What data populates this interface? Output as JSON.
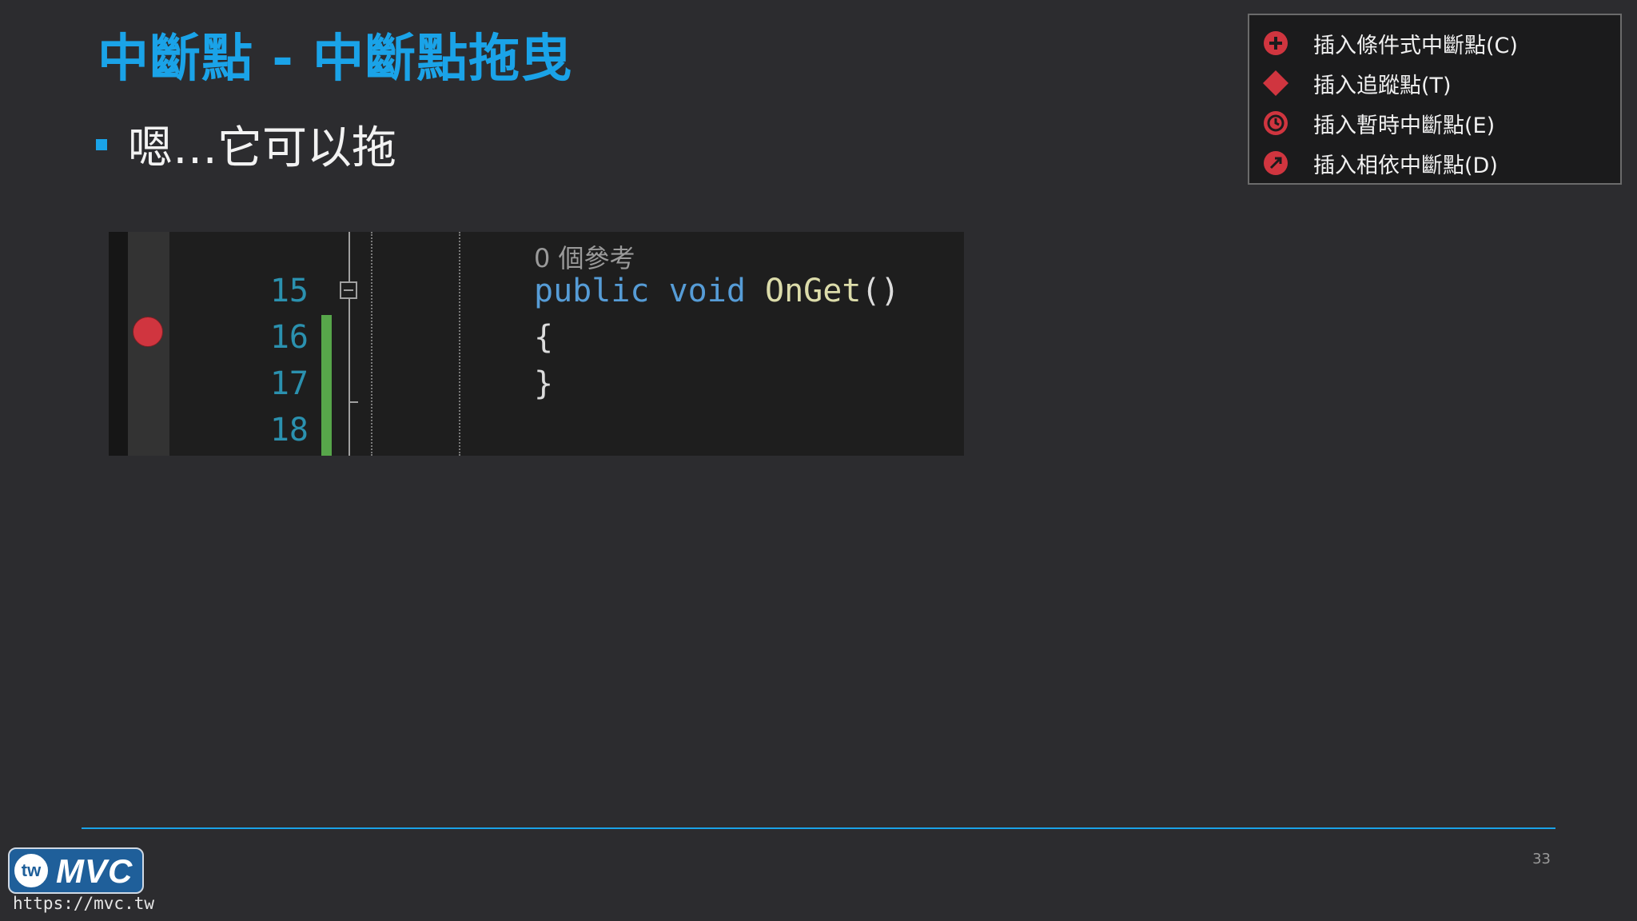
{
  "slide": {
    "title": "中斷點 - 中斷點拖曳",
    "bullet": "嗯…它可以拖",
    "page_number": "33",
    "colors": {
      "accent": "#1aa3e8",
      "background": "#2c2c2f",
      "breakpoint": "#d0353f"
    }
  },
  "editor": {
    "codelens": "0 個參考",
    "line_numbers": [
      "15",
      "16",
      "17",
      "18"
    ],
    "code": {
      "kw_public": "public",
      "kw_void": "void",
      "method": "OnGet",
      "parens": "()",
      "open_brace": "{",
      "close_brace": "}"
    }
  },
  "context_menu": {
    "items": [
      {
        "label": "插入條件式中斷點(C)",
        "icon": "conditional-breakpoint-icon"
      },
      {
        "label": "插入追蹤點(T)",
        "icon": "tracepoint-icon"
      },
      {
        "label": "插入暫時中斷點(E)",
        "icon": "temporary-breakpoint-icon"
      },
      {
        "label": "插入相依中斷點(D)",
        "icon": "dependent-breakpoint-icon"
      }
    ]
  },
  "footer": {
    "logo_badge": "tw",
    "logo_text": "MVC",
    "url": "https://mvc.tw"
  }
}
